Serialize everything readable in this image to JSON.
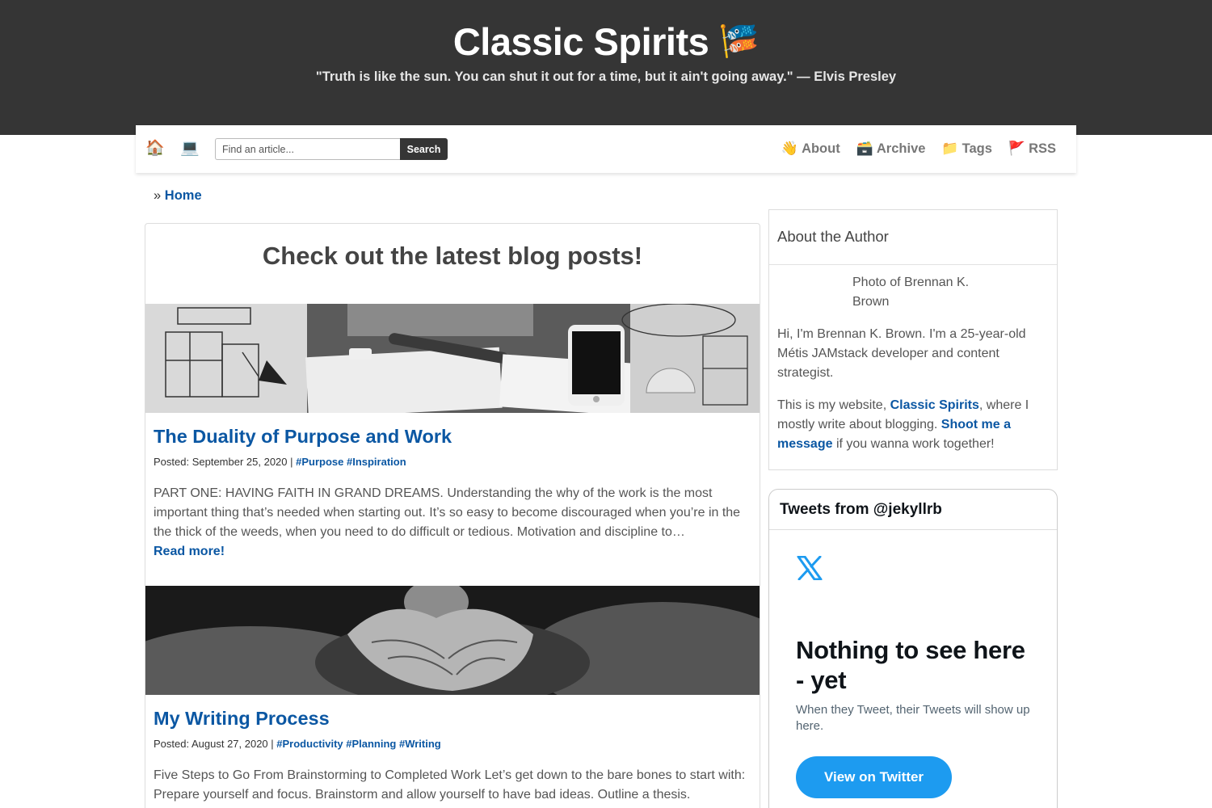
{
  "header": {
    "title": "Classic Spirits",
    "title_emoji": "🎏",
    "tagline": "\"Truth is like the sun. You can shut it out for a time, but it ain't going away.\" — Elvis Presley"
  },
  "nav": {
    "home_icon": "🏠",
    "laptop_icon": "💻",
    "search_placeholder": "Find an article...",
    "search_button": "Search",
    "links": [
      {
        "icon": "👋",
        "label": "About"
      },
      {
        "icon": "🗃️",
        "label": "Archive"
      },
      {
        "icon": "📁",
        "label": "Tags"
      },
      {
        "icon": "🚩",
        "label": "RSS"
      }
    ]
  },
  "breadcrumb": {
    "separator": "»",
    "home": "Home"
  },
  "main": {
    "heading": "Check out the latest blog posts!",
    "posts": [
      {
        "title": "The Duality of Purpose and Work",
        "posted": "Posted: September 25, 2020 |",
        "tags": "#Purpose #Inspiration",
        "excerpt": "PART ONE: HAVING FAITH IN GRAND DREAMS. Understanding the why of the work is the most important thing that’s needed when starting out. It’s so easy to become discouraged when you’re in the the thick of the weeds, when you need to do difficult or tedious. Motivation and discipline to…",
        "read_more": "Read more!"
      },
      {
        "title": "My Writing Process",
        "posted": "Posted: August 27, 2020 |",
        "tags": "#Productivity #Planning #Writing",
        "excerpt": "Five Steps to Go From Brainstorming to Completed Work Let’s get down to the bare bones to start with: Prepare yourself and focus. Brainstorm and allow yourself to have bad ideas. Outline a thesis."
      }
    ]
  },
  "sidebar": {
    "about_title": "About the Author",
    "photo_alt": "Photo of Brennan K. Brown",
    "bio": "Hi, I'm Brennan K. Brown. I'm a 25-year-old Métis JAMstack developer and content strategist.",
    "site_pre": "This is my website, ",
    "site_link": "Classic Spirits",
    "site_mid": ", where I mostly write about blogging. ",
    "contact_link": "Shoot me a message",
    "site_post": " if you wanna work together!"
  },
  "twitter": {
    "heading": "Tweets from @jekyllrb",
    "logo": "x-logo-icon",
    "empty_title": "Nothing to see here - yet",
    "empty_sub": "When they Tweet, their Tweets will show up here.",
    "button": "View on Twitter",
    "accent": "#1d9bf0"
  }
}
